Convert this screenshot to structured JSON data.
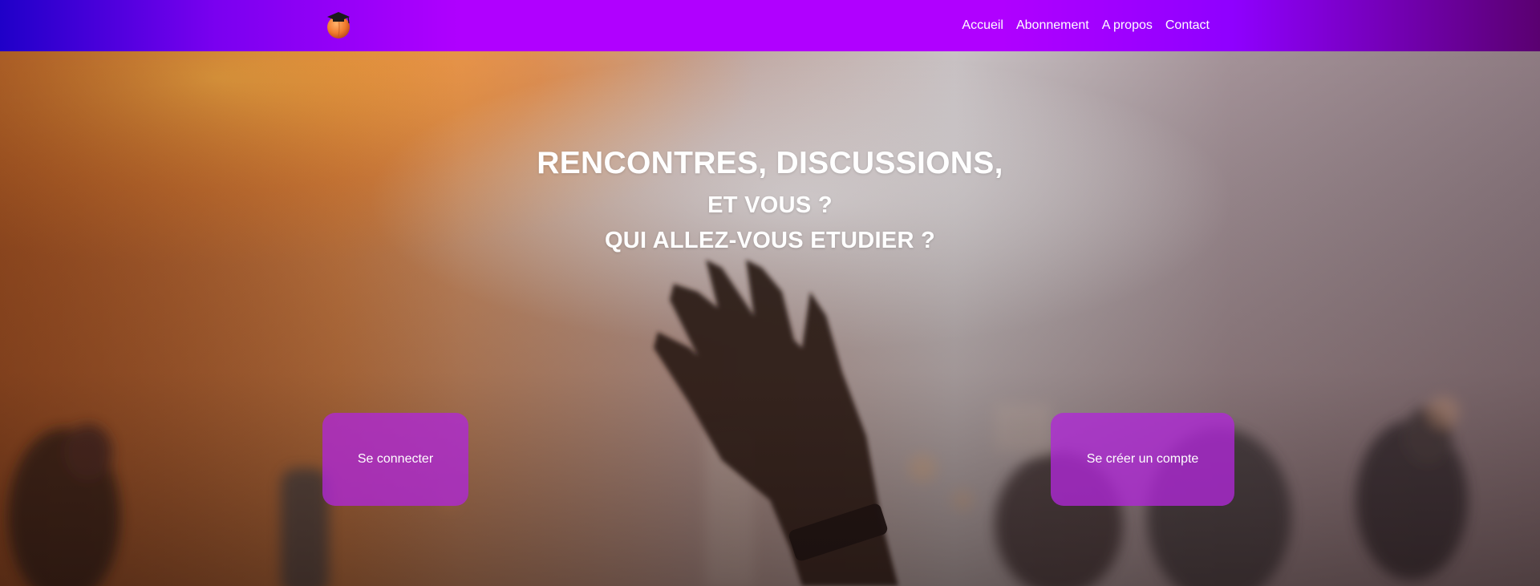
{
  "brand": {
    "logo_icon": "peach-with-graduation-cap-icon"
  },
  "nav": {
    "items": [
      {
        "label": "Accueil"
      },
      {
        "label": "Abonnement"
      },
      {
        "label": "A propos"
      },
      {
        "label": "Contact"
      }
    ]
  },
  "hero": {
    "line1": "RENCONTRES, DISCUSSIONS,",
    "line2": "ET VOUS ?",
    "line3": "QUI ALLEZ-VOUS ETUDIER ?",
    "login_label": "Se connecter",
    "signup_label": "Se créer un compte"
  },
  "colors": {
    "nav_gradient_start": "#1f00c8",
    "nav_gradient_mid": "#b000ff",
    "nav_gradient_end": "#5a0070",
    "button_fill": "#b028d7"
  }
}
